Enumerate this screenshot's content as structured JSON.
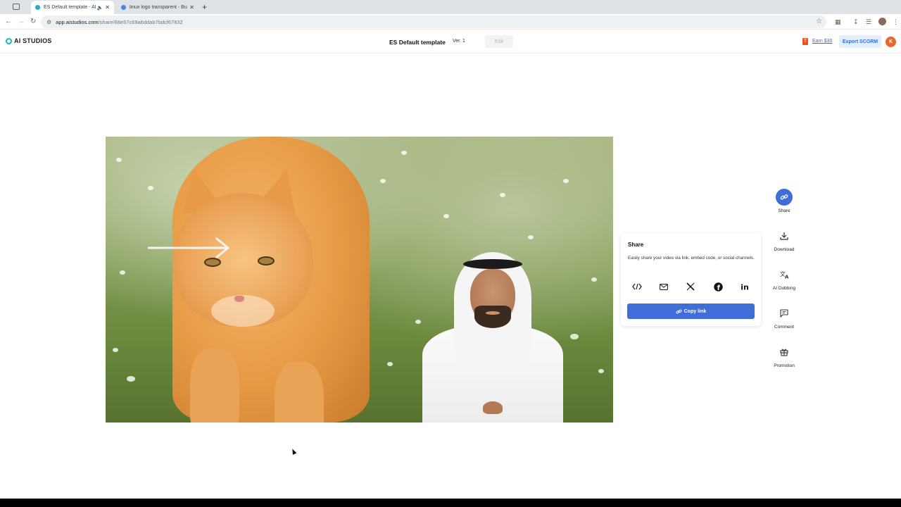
{
  "browser": {
    "tabs": [
      {
        "title": "ES Default template - AI S",
        "active": true
      },
      {
        "title": "linux logo transparent - Busc",
        "active": false
      }
    ],
    "url_host": "app.aistudios.com",
    "url_path": "/share/68e57c69a6ddab7bdcf67832"
  },
  "header": {
    "logo_text": "AI STUDIOS",
    "doc_title": "ES Default template",
    "version": "Ver. 1",
    "edit_label": "Edit",
    "earn_label": "Earn $30",
    "export_label": "Export SCORM",
    "avatar_initial": "K"
  },
  "share_popover": {
    "heading": "Share",
    "description": "Easily share your video via link, embed code, or social channels.",
    "copy_label": "Copy link"
  },
  "rail": {
    "share": "Share",
    "download": "Download",
    "dubbing": "AI Dubbing",
    "comment": "Comment",
    "promotion": "Promotion"
  },
  "colors": {
    "accent": "#3f6ed8",
    "export_bg": "#e5eeff",
    "logo": "#19b3c6",
    "avatar": "#e8672a"
  }
}
